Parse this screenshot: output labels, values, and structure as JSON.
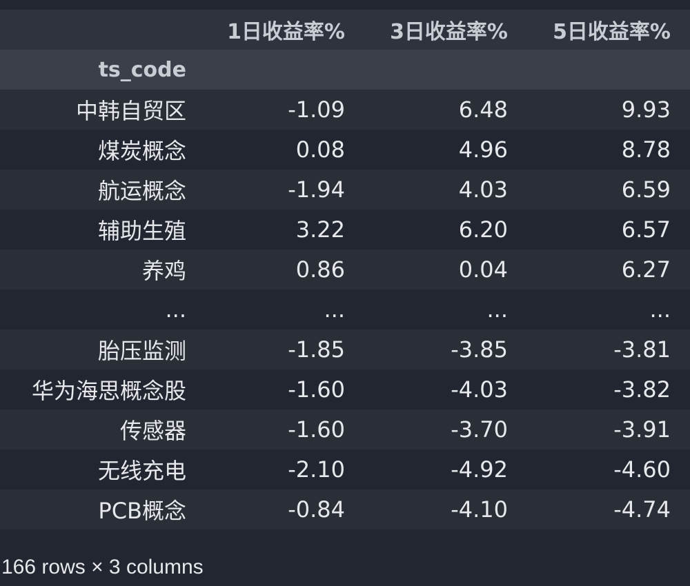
{
  "table": {
    "columns": [
      "1日收益率%",
      "3日收益率%",
      "5日收益率%"
    ],
    "index_name": "ts_code",
    "rows": [
      {
        "index": "中韩自贸区",
        "values": [
          "-1.09",
          "6.48",
          "9.93"
        ]
      },
      {
        "index": "煤炭概念",
        "values": [
          "0.08",
          "4.96",
          "8.78"
        ]
      },
      {
        "index": "航运概念",
        "values": [
          "-1.94",
          "4.03",
          "6.59"
        ]
      },
      {
        "index": "辅助生殖",
        "values": [
          "3.22",
          "6.20",
          "6.57"
        ]
      },
      {
        "index": "养鸡",
        "values": [
          "0.86",
          "0.04",
          "6.27"
        ]
      },
      {
        "index": "...",
        "values": [
          "...",
          "...",
          "..."
        ]
      },
      {
        "index": "胎压监测",
        "values": [
          "-1.85",
          "-3.85",
          "-3.81"
        ]
      },
      {
        "index": "华为海思概念股",
        "values": [
          "-1.60",
          "-4.03",
          "-3.82"
        ]
      },
      {
        "index": "传感器",
        "values": [
          "-1.60",
          "-3.70",
          "-3.91"
        ]
      },
      {
        "index": "无线充电",
        "values": [
          "-2.10",
          "-4.92",
          "-4.60"
        ]
      },
      {
        "index": "PCB概念",
        "values": [
          "-0.84",
          "-4.10",
          "-4.74"
        ]
      }
    ]
  },
  "footer": {
    "shape_text": "166 rows × 3 columns"
  }
}
